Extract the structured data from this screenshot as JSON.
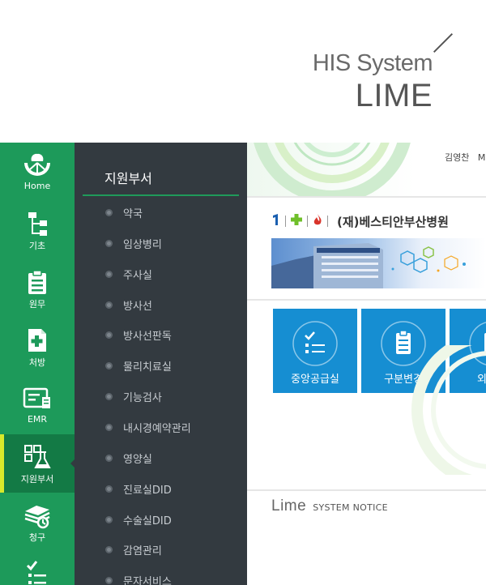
{
  "brand": {
    "subtitle": "HIS System",
    "title": "LIME"
  },
  "rail": {
    "items": [
      {
        "label": "Home",
        "icon": "lime-slice-icon"
      },
      {
        "label": "기초",
        "icon": "hierarchy-icon"
      },
      {
        "label": "원무",
        "icon": "clipboard-icon"
      },
      {
        "label": "처방",
        "icon": "prescription-icon"
      },
      {
        "label": "EMR",
        "icon": "emr-chart-icon"
      },
      {
        "label": "지원부서",
        "icon": "lab-flask-icon",
        "active": true
      },
      {
        "label": "청구",
        "icon": "money-stack-icon"
      },
      {
        "label": "",
        "icon": "checklist-icon"
      }
    ]
  },
  "submenu": {
    "title": "지원부서",
    "items": [
      "약국",
      "임상병리",
      "주사실",
      "방사선",
      "방사선판독",
      "물리치료실",
      "기능검사",
      "내시경예약관리",
      "영양실",
      "진료실DID",
      "수술실DID",
      "감염관리",
      "문자서비스"
    ]
  },
  "main": {
    "user_name": "김영찬",
    "user_extra": "M",
    "hospital_name": "(재)베스티안부산병원",
    "tiles": [
      {
        "label": "중앙공급실",
        "icon": "checklist-icon"
      },
      {
        "label": "구분변경",
        "icon": "clipboard-icon"
      },
      {
        "label": "외래접",
        "icon": "clipboard-icon"
      }
    ],
    "notice": {
      "logo": "Lime",
      "label": "SYSTEM NOTICE"
    }
  },
  "colors": {
    "rail_green": "#1d9a5a",
    "rail_active": "#137a45",
    "active_marker": "#d8e92b",
    "submenu_bg": "#333a40",
    "tile_blue": "#168ed2"
  }
}
